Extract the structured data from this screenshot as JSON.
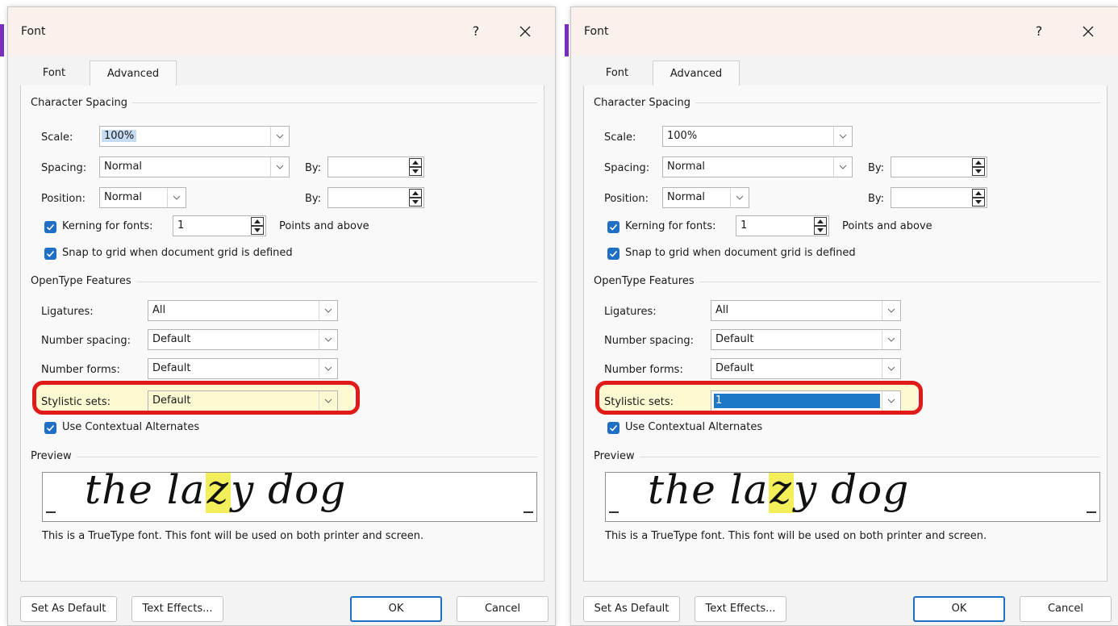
{
  "dialogs": [
    {
      "title": "Font",
      "help": "?",
      "tabs": [
        "Font",
        "Advanced"
      ],
      "character_spacing": {
        "heading": "Character Spacing",
        "scale_label": "Scale:",
        "scale_value": "100%",
        "spacing_label": "Spacing:",
        "spacing_value": "Normal",
        "position_label": "Position:",
        "position_value": "Normal",
        "by_label": "By:",
        "spacing_by": "",
        "position_by": "",
        "kerning_label": "Kerning for fonts:",
        "kerning_value": "1",
        "kerning_suffix": "Points and above",
        "snap_label": "Snap to grid when document grid is defined"
      },
      "opentype": {
        "heading": "OpenType Features",
        "ligatures_label": "Ligatures:",
        "ligatures_value": "All",
        "number_spacing_label": "Number spacing:",
        "number_spacing_value": "Default",
        "number_forms_label": "Number forms:",
        "number_forms_value": "Default",
        "stylistic_label": "Stylistic sets:",
        "stylistic_value": "Default",
        "contextual_label": "Use Contextual Alternates"
      },
      "preview": {
        "heading": "Preview",
        "before": "the la",
        "highlight": "z",
        "after": "y dog",
        "note": "This is a TrueType font. This font will be used on both printer and screen."
      },
      "buttons": {
        "set_default": "Set As Default",
        "text_effects": "Text Effects...",
        "ok": "OK",
        "cancel": "Cancel"
      }
    },
    {
      "title": "Font",
      "help": "?",
      "tabs": [
        "Font",
        "Advanced"
      ],
      "character_spacing": {
        "heading": "Character Spacing",
        "scale_label": "Scale:",
        "scale_value": "100%",
        "spacing_label": "Spacing:",
        "spacing_value": "Normal",
        "position_label": "Position:",
        "position_value": "Normal",
        "by_label": "By:",
        "spacing_by": "",
        "position_by": "",
        "kerning_label": "Kerning for fonts:",
        "kerning_value": "1",
        "kerning_suffix": "Points and above",
        "snap_label": "Snap to grid when document grid is defined"
      },
      "opentype": {
        "heading": "OpenType Features",
        "ligatures_label": "Ligatures:",
        "ligatures_value": "All",
        "number_spacing_label": "Number spacing:",
        "number_spacing_value": "Default",
        "number_forms_label": "Number forms:",
        "number_forms_value": "Default",
        "stylistic_label": "Stylistic sets:",
        "stylistic_value": "1",
        "contextual_label": "Use Contextual Alternates"
      },
      "preview": {
        "heading": "Preview",
        "before": "the la",
        "highlight": "z",
        "after": "y dog",
        "note": "This is a TrueType font. This font will be used on both printer and screen."
      },
      "buttons": {
        "set_default": "Set As Default",
        "text_effects": "Text Effects...",
        "ok": "OK",
        "cancel": "Cancel"
      }
    }
  ],
  "colors": {
    "accent": "#1f6fc5",
    "annotation_ring": "#e01919",
    "preview_highlight": "#f2ef5a",
    "selected_dropdown": "#1e78c8",
    "titlebar": "#faf1ec"
  },
  "icons": [
    "close-icon",
    "chevron-down-icon",
    "spin-up-icon",
    "spin-down-icon",
    "checkmark-icon"
  ]
}
